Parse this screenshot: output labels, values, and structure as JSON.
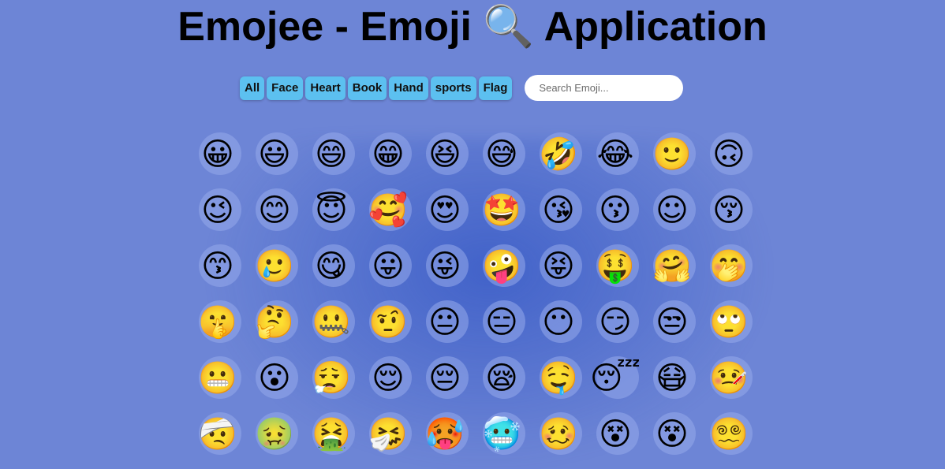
{
  "header": {
    "title": "Emojee - Emoji 🔍 Application"
  },
  "categories": [
    {
      "label": "All"
    },
    {
      "label": "Face"
    },
    {
      "label": "Heart"
    },
    {
      "label": "Book"
    },
    {
      "label": "Hand"
    },
    {
      "label": "sports"
    },
    {
      "label": "Flag"
    }
  ],
  "search": {
    "placeholder": "Search Emoji...",
    "value": ""
  },
  "emojis": [
    "😀",
    "😃",
    "😄",
    "😁",
    "😆",
    "😅",
    "🤣",
    "😂",
    "🙂",
    "🙃",
    "😉",
    "😊",
    "😇",
    "🥰",
    "😍",
    "🤩",
    "😘",
    "😗",
    "☺",
    "😚",
    "😙",
    "🥲",
    "😋",
    "😛",
    "😜",
    "🤪",
    "😝",
    "🤑",
    "🤗",
    "🤭",
    "🤫",
    "🤔",
    "🤐",
    "🤨",
    "😐",
    "😑",
    "😶",
    "😏",
    "😒",
    "🙄",
    "😬",
    "😮",
    "😮‍💨",
    "😌",
    "😔",
    "😪",
    "🤤",
    "😴",
    "😷",
    "🤒",
    "🤕",
    "🤢",
    "🤮",
    "🤧",
    "🥵",
    "🥶",
    "🥴",
    "😵",
    "😵",
    "😵‍💫"
  ]
}
